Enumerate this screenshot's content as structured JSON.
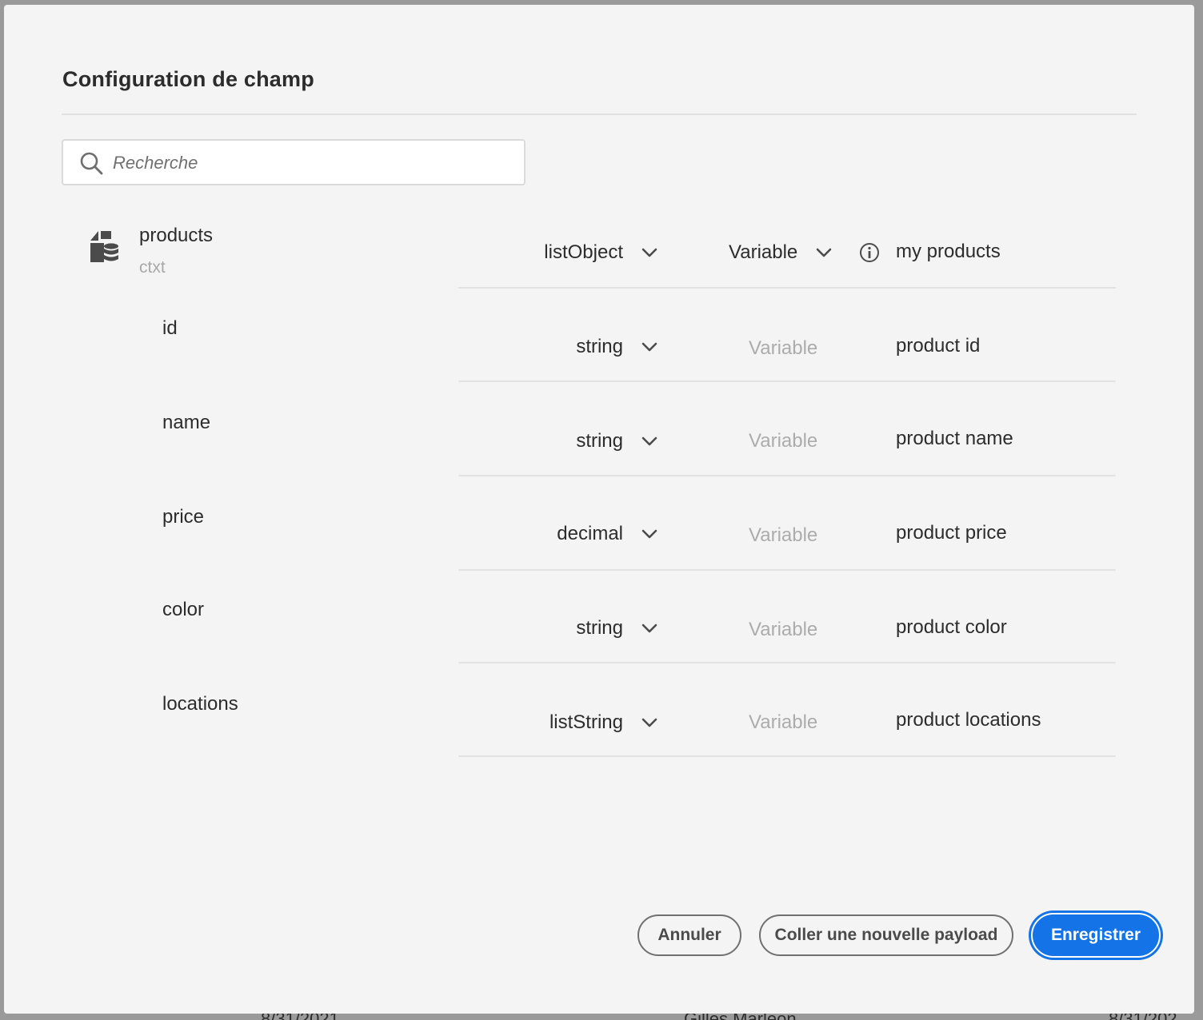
{
  "dialog": {
    "title": "Configuration de champ",
    "search": {
      "placeholder": "Recherche",
      "value": ""
    },
    "root": {
      "name": "products",
      "context": "ctxt",
      "type": "listObject",
      "variable": "Variable",
      "description": "my products"
    },
    "fields": [
      {
        "name": "id",
        "type": "string",
        "variable": "Variable",
        "description": "product id"
      },
      {
        "name": "name",
        "type": "string",
        "variable": "Variable",
        "description": "product name"
      },
      {
        "name": "price",
        "type": "decimal",
        "variable": "Variable",
        "description": "product price"
      },
      {
        "name": "color",
        "type": "string",
        "variable": "Variable",
        "description": "product color"
      },
      {
        "name": "locations",
        "type": "listString",
        "variable": "Variable",
        "description": "product locations"
      }
    ],
    "buttons": {
      "cancel": "Annuler",
      "paste": "Coller une nouvelle payload",
      "save": "Enregistrer"
    }
  },
  "colors": {
    "primary": "#1473e6",
    "dialog_bg": "#f4f4f4",
    "disabled_text": "#acacac"
  },
  "icons": [
    "search-icon",
    "object-list-icon",
    "chevron-down-icon",
    "info-icon"
  ]
}
